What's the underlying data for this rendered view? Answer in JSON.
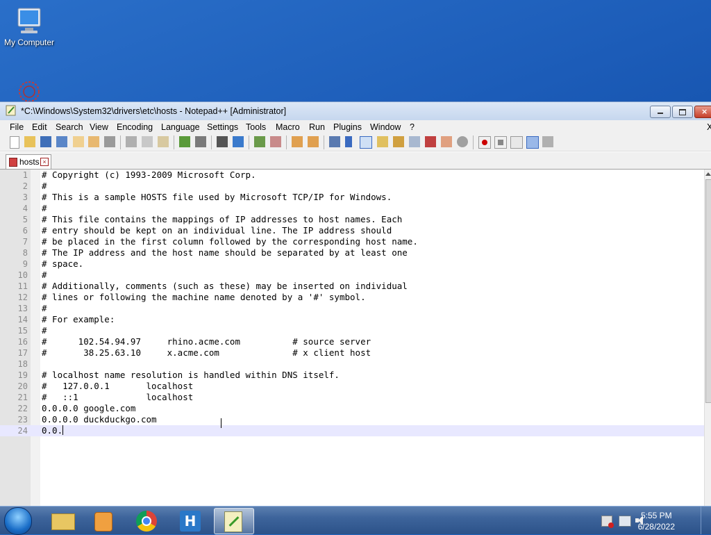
{
  "desktop": {
    "icons": [
      {
        "label": "My Computer",
        "icon": "computer-icon"
      },
      {
        "label": "",
        "icon": "recycle-bin-icon"
      }
    ]
  },
  "window": {
    "title": "*C:\\Windows\\System32\\drivers\\etc\\hosts - Notepad++ [Administrator]",
    "app_icon": "notepad-plus-plus-icon"
  },
  "menu": {
    "items": [
      "File",
      "Edit",
      "Search",
      "View",
      "Encoding",
      "Language",
      "Settings",
      "Tools",
      "Macro",
      "Run",
      "Plugins",
      "Window",
      "?"
    ],
    "close_x": "X"
  },
  "toolbar": {
    "icons": [
      "new-icon",
      "open-icon",
      "save-icon",
      "save-all-icon",
      "close-icon",
      "close-all-icon",
      "print-icon",
      "cut-icon",
      "copy-icon",
      "paste-icon",
      "undo-icon",
      "redo-icon",
      "find-icon",
      "replace-icon",
      "zoom-in-icon",
      "zoom-out-icon",
      "sync-v-icon",
      "sync-h-icon",
      "word-wrap-icon",
      "show-all-chars-icon",
      "indent-guide-icon",
      "doc-map-icon",
      "function-list-icon",
      "folder-workspace-icon",
      "monitoring-icon",
      "record-macro-icon",
      "stop-macro-icon",
      "play-macro-icon",
      "run-macro-multiple-icon",
      "save-macro-icon"
    ]
  },
  "tab": {
    "label": "hosts"
  },
  "editor": {
    "current_line": 24,
    "lines": [
      "# Copyright (c) 1993-2009 Microsoft Corp.",
      "#",
      "# This is a sample HOSTS file used by Microsoft TCP/IP for Windows.",
      "#",
      "# This file contains the mappings of IP addresses to host names. Each",
      "# entry should be kept on an individual line. The IP address should",
      "# be placed in the first column followed by the corresponding host name.",
      "# The IP address and the host name should be separated by at least one",
      "# space.",
      "#",
      "# Additionally, comments (such as these) may be inserted on individual",
      "# lines or following the machine name denoted by a '#' symbol.",
      "#",
      "# For example:",
      "#",
      "#      102.54.94.97     rhino.acme.com          # source server",
      "#       38.25.63.10     x.acme.com              # x client host",
      "",
      "# localhost name resolution is handled within DNS itself.",
      "#   127.0.0.1       localhost",
      "#   ::1             localhost",
      "0.0.0.0 google.com",
      "0.0.0.0 duckduckgo.com",
      "0.0."
    ]
  },
  "taskbar": {
    "items": [
      "start-orb-icon",
      "explorer-icon",
      "media-player-icon",
      "chrome-icon",
      "app-h-icon",
      "notepad-plus-plus-icon"
    ],
    "tray": [
      "action-center-icon",
      "network-icon",
      "volume-icon"
    ],
    "time": "5:55 PM",
    "date": "6/28/2022"
  }
}
